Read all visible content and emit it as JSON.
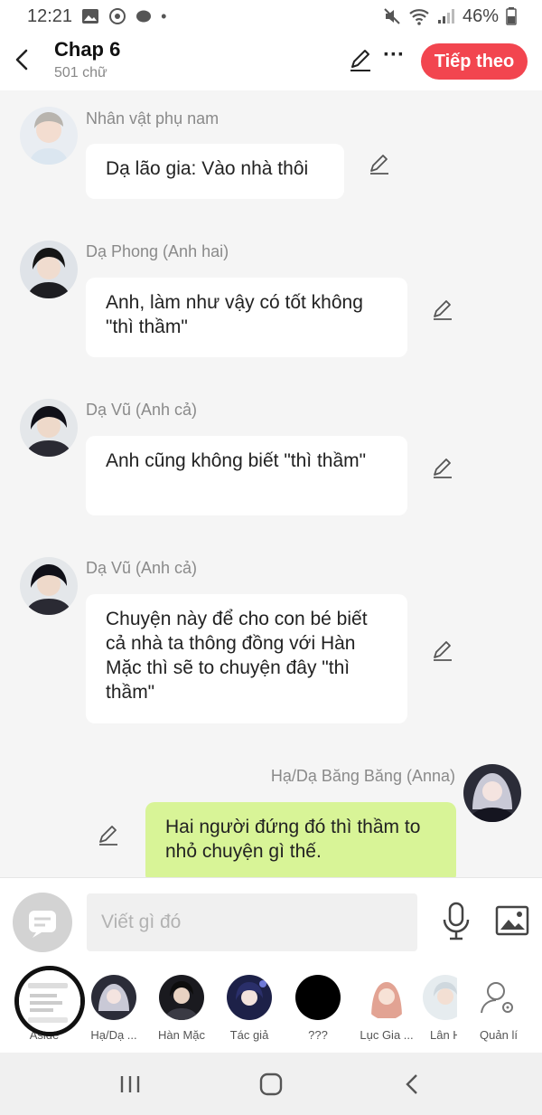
{
  "status_bar": {
    "time": "12:21",
    "battery": "46%"
  },
  "header": {
    "title": "Chap 6",
    "word_count": "501 chữ",
    "next_button": "Tiếp theo"
  },
  "messages": [
    {
      "speaker": "Nhân vật phụ nam",
      "text": "Dạ lão gia: Vào nhà thôi"
    },
    {
      "speaker": "Dạ Phong (Anh hai)",
      "text": "Anh, làm như vậy có tốt không \"thì thầm\""
    },
    {
      "speaker": "Dạ Vũ (Anh cả)",
      "text": "Anh cũng không biết \"thì thầm\""
    },
    {
      "speaker": "Dạ Vũ (Anh cả)",
      "text": "Chuyện này để cho con bé biết cả nhà ta thông đồng với Hàn Mặc thì sẽ to chuyện đây \"thì thầm\""
    },
    {
      "speaker": "Hạ/Dạ Băng Băng (Anna)",
      "text": "Hai người đứng đó thì thầm to nhỏ chuyện gì thế."
    }
  ],
  "composer": {
    "placeholder": "Viết gì đó"
  },
  "characters": [
    {
      "label": "Aside"
    },
    {
      "label": "Hạ/Dạ ..."
    },
    {
      "label": "Hàn Mặc"
    },
    {
      "label": "Tác giả"
    },
    {
      "label": "???"
    },
    {
      "label": "Lục Gia ..."
    },
    {
      "label": "Lân H"
    },
    {
      "label": "Quản lí"
    }
  ],
  "colors": {
    "accent": "#f2454f",
    "my_bubble": "#d8f497",
    "other_bubble": "#ffffff"
  }
}
